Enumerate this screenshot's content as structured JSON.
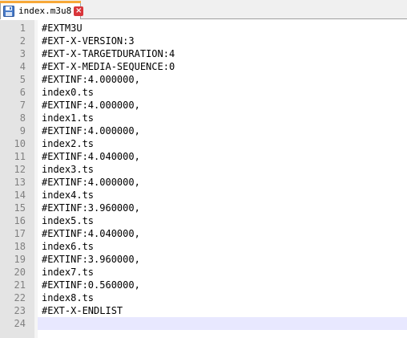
{
  "tab": {
    "filename": "index.m3u8",
    "close_glyph": "×"
  },
  "colors": {
    "accent": "#f7a839",
    "current_line": "#e8e8ff",
    "gutter": "#e4e4e4"
  },
  "lines": [
    {
      "number": "1",
      "text": "#EXTM3U"
    },
    {
      "number": "2",
      "text": "#EXT-X-VERSION:3"
    },
    {
      "number": "3",
      "text": "#EXT-X-TARGETDURATION:4"
    },
    {
      "number": "4",
      "text": "#EXT-X-MEDIA-SEQUENCE:0"
    },
    {
      "number": "5",
      "text": "#EXTINF:4.000000,"
    },
    {
      "number": "6",
      "text": "index0.ts"
    },
    {
      "number": "7",
      "text": "#EXTINF:4.000000,"
    },
    {
      "number": "8",
      "text": "index1.ts"
    },
    {
      "number": "9",
      "text": "#EXTINF:4.000000,"
    },
    {
      "number": "10",
      "text": "index2.ts"
    },
    {
      "number": "11",
      "text": "#EXTINF:4.040000,"
    },
    {
      "number": "12",
      "text": "index3.ts"
    },
    {
      "number": "13",
      "text": "#EXTINF:4.000000,"
    },
    {
      "number": "14",
      "text": "index4.ts"
    },
    {
      "number": "15",
      "text": "#EXTINF:3.960000,"
    },
    {
      "number": "16",
      "text": "index5.ts"
    },
    {
      "number": "17",
      "text": "#EXTINF:4.040000,"
    },
    {
      "number": "18",
      "text": "index6.ts"
    },
    {
      "number": "19",
      "text": "#EXTINF:3.960000,"
    },
    {
      "number": "20",
      "text": "index7.ts"
    },
    {
      "number": "21",
      "text": "#EXTINF:0.560000,"
    },
    {
      "number": "22",
      "text": "index8.ts"
    },
    {
      "number": "23",
      "text": "#EXT-X-ENDLIST"
    },
    {
      "number": "24",
      "text": ""
    }
  ],
  "current_line": 24
}
